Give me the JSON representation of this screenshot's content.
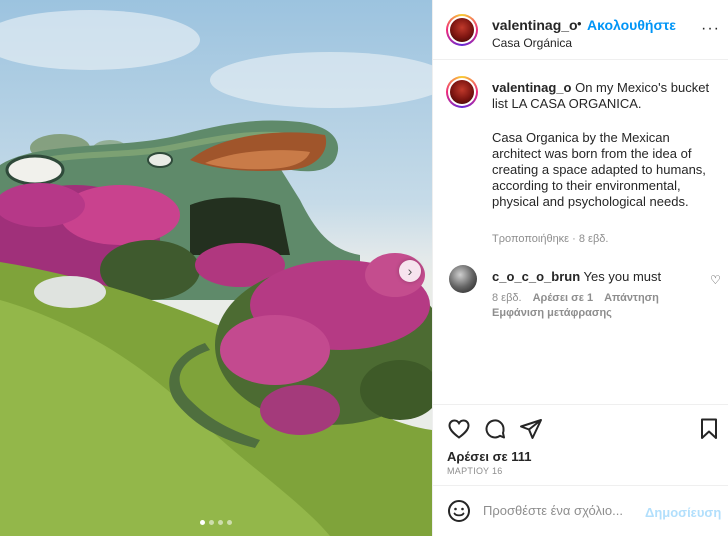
{
  "post": {
    "username": "valentinag_o",
    "dot": "•",
    "follow_label": "Ακολουθήστε",
    "location": "Casa Orgánica",
    "more_label": "···"
  },
  "caption": {
    "username": "valentinag_o",
    "first_line": "On my Mexico's bucket list LA CASA ORGANICA.",
    "paragraph": "Casa Organica by the Mexican architect was born from the idea of creating a space adapted to humans, according to their environmental, physical and psychological needs.",
    "meta": "Τροποποιήθηκε · 8 εβδ."
  },
  "comment": {
    "username": "c_o_c_o_brun",
    "text": "Yes you must",
    "age": "8 εβδ.",
    "likes": "Αρέσει σε 1",
    "reply": "Απάντηση",
    "translate": "Εμφάνιση μετάφρασης"
  },
  "actions": {
    "likes_label": "Αρέσει σε 111",
    "date": "ΜΑΡΤΙΟΥ 16"
  },
  "comment_bar": {
    "placeholder": "Προσθέστε ένα σχόλιο...",
    "post_label": "Δημοσίευση"
  },
  "carousel": {
    "current": 1,
    "total": 4
  },
  "colors": {
    "accent": "#0095f6",
    "post_disabled": "#b2dffc",
    "muted": "#8e8e8e"
  },
  "icons": [
    "heart-icon",
    "comment-icon",
    "share-icon",
    "bookmark-icon",
    "emoji-icon",
    "chevron-right-icon",
    "more-icon"
  ]
}
